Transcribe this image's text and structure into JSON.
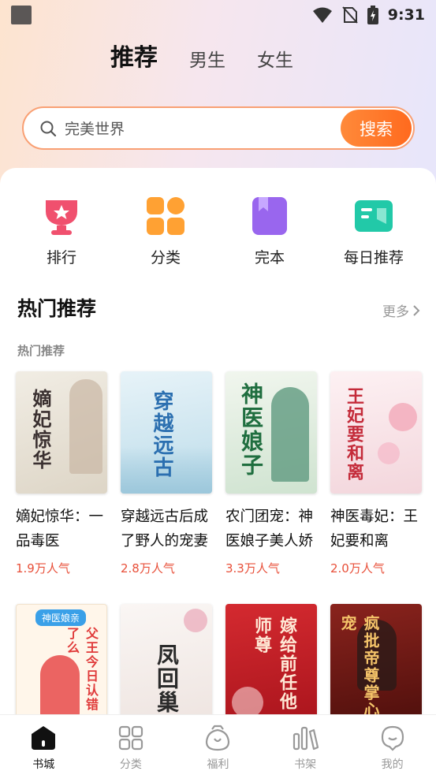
{
  "status": {
    "time": "9:31"
  },
  "tabs": [
    {
      "label": "推荐",
      "active": true
    },
    {
      "label": "男生",
      "active": false
    },
    {
      "label": "女生",
      "active": false
    }
  ],
  "search": {
    "value": "完美世界",
    "button_label": "搜索"
  },
  "quick_links": [
    {
      "label": "排行",
      "icon": "trophy-icon",
      "color": "#f0506e"
    },
    {
      "label": "分类",
      "icon": "grid-icon",
      "color": "#ffa133"
    },
    {
      "label": "完本",
      "icon": "book-icon",
      "color": "#9966ee"
    },
    {
      "label": "每日推荐",
      "icon": "notebook-icon",
      "color": "#22c9a8"
    }
  ],
  "section": {
    "title": "热门推荐",
    "more_label": "更多",
    "subtitle": "热门推荐"
  },
  "books": [
    {
      "title": "嫡妃惊华：一品毒医",
      "popularity": "1.9万人气",
      "cover_text": "嫡妃惊华",
      "cover_color": "#ece7de"
    },
    {
      "title": "穿越远古后成了野人的宠妻",
      "popularity": "2.8万人气",
      "cover_text": "穿越远古",
      "cover_color": "#d9ecf4"
    },
    {
      "title": "农门团宠：神医娘子美人娇",
      "popularity": "3.3万人气",
      "cover_text": "神医娘子",
      "cover_color": "#e4efe4"
    },
    {
      "title": "神医毒妃：王妃要和离",
      "popularity": "2.0万人气",
      "cover_text": "王妃要和离",
      "cover_color": "#f8e7ea"
    }
  ],
  "books_row2": [
    {
      "cover_text": "父王今日认错了么",
      "cover_color": "#fff6ea",
      "badge": "神医娘亲"
    },
    {
      "cover_text": "凤回巢",
      "cover_color": "#f6f2f0"
    },
    {
      "cover_text": "嫁给前任他师尊",
      "cover_color": "#c8202a"
    },
    {
      "cover_text": "疯批帝尊掌心宠",
      "cover_color": "#7a1a16"
    }
  ],
  "bottom_nav": [
    {
      "label": "书城",
      "icon": "bookstore-icon",
      "active": true
    },
    {
      "label": "分类",
      "icon": "category-icon",
      "active": false
    },
    {
      "label": "福利",
      "icon": "welfare-icon",
      "active": false
    },
    {
      "label": "书架",
      "icon": "bookshelf-icon",
      "active": false
    },
    {
      "label": "我的",
      "icon": "profile-icon",
      "active": false
    }
  ],
  "colors": {
    "accent": "#ff6a1e",
    "popularity": "#e8503a"
  }
}
